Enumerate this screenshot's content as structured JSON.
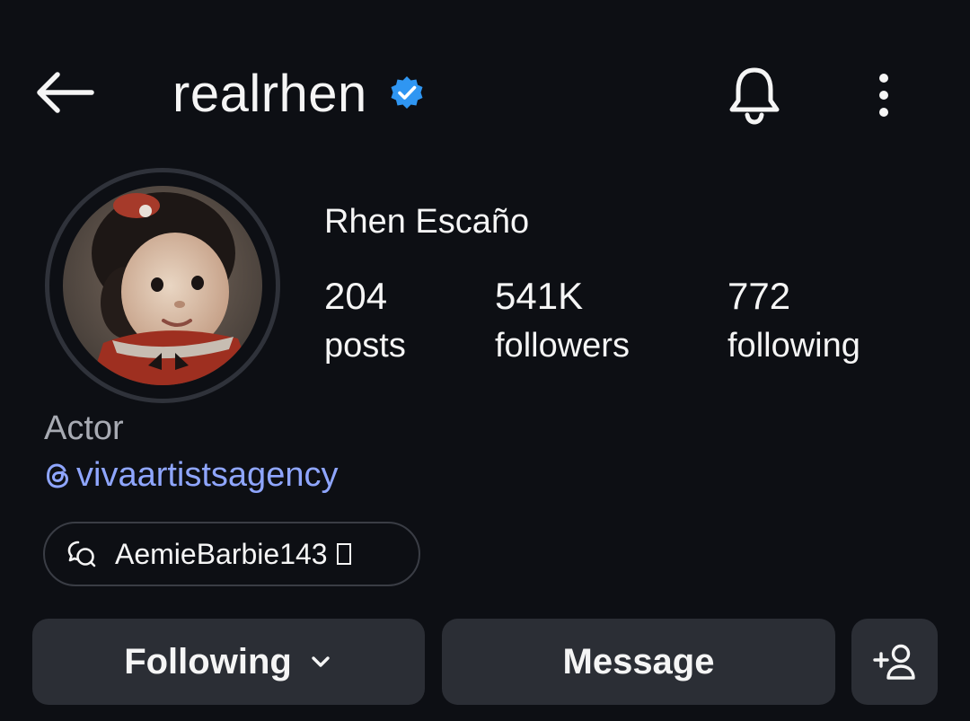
{
  "header": {
    "username": "realrhen",
    "verified": true,
    "back_icon": "arrow-left-icon",
    "notification_icon": "bell-icon",
    "more_icon": "more-vertical-icon"
  },
  "profile": {
    "full_name": "Rhen Escaño",
    "stats": [
      {
        "value": "204",
        "label": "posts"
      },
      {
        "value": "541K",
        "label": "followers"
      },
      {
        "value": "772",
        "label": "following"
      }
    ],
    "bio": "Actor",
    "threads_link": "vivaartistsagency",
    "chip_text": "AemieBarbie143"
  },
  "actions": {
    "following_label": "Following",
    "message_label": "Message",
    "add_user_icon": "add-person-icon"
  },
  "colors": {
    "background": "#0d0f14",
    "button_bg": "#2b2e35",
    "verified": "#2f96f2",
    "link": "#8fa6ff",
    "muted_text": "#a8abb3"
  }
}
